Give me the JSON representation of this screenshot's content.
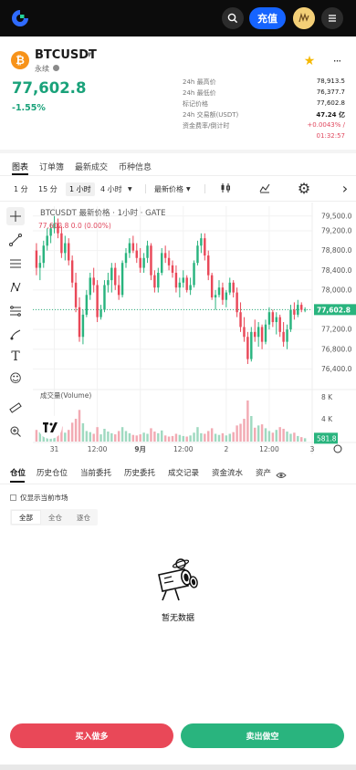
{
  "app": {
    "deposit_label": "充值"
  },
  "ticker": {
    "symbol": "BTCUSDT",
    "contract_type": "永续",
    "last_price": "77,602.8",
    "change_pct": "-1.55%",
    "stats": [
      {
        "label": "24h 最高价",
        "value": "78,913.5"
      },
      {
        "label": "24h 最低价",
        "value": "76,377.7"
      },
      {
        "label": "标记价格",
        "value": "77,602.8"
      },
      {
        "label": "24h 交易额(USDT)",
        "value": "47.24 亿"
      },
      {
        "label": "资金费率/倒计时",
        "value": "+0.0043% /"
      }
    ],
    "funding_countdown": "01:32:57"
  },
  "tabs": [
    "图表",
    "订单簿",
    "最新成交",
    "币种信息"
  ],
  "toolbar": {
    "intervals": [
      "1 分",
      "15 分",
      "1 小时",
      "4 小时"
    ],
    "active_interval": "1 小时",
    "price_mode": "最新价格"
  },
  "chart_header": {
    "title": "BTCUSDT 最新价格 · 1小时 · GATE",
    "ohlc": "77,602.8  0.0 (0.00%)",
    "volume_label": "成交量(Volume)"
  },
  "chart_data": {
    "type": "candlestick",
    "interval": "1h",
    "y_ticks": [
      "79,500.0",
      "79,200.0",
      "78,800.0",
      "78,400.0",
      "78,000.0",
      "77,600.0",
      "77,200.0",
      "76,800.0",
      "76,400.0"
    ],
    "y_tick_values": [
      79500,
      79200,
      78800,
      78400,
      78000,
      77600,
      77200,
      76800,
      76400
    ],
    "ylim": [
      76000,
      79700
    ],
    "last_price": 77602.8,
    "last_price_label": "77,602.8",
    "volume_ticks": [
      "8 K",
      "4 K"
    ],
    "volume_tick_values": [
      8000,
      4000
    ],
    "volume_ylim": [
      0,
      9200
    ],
    "last_volume_label": "581.8",
    "x_ticks": [
      "31",
      "12:00",
      "9月",
      "12:00",
      "2",
      "12:00",
      "3"
    ],
    "x_tick_index": [
      5,
      17,
      29,
      41,
      53,
      65,
      77
    ],
    "candles": [
      [
        78800,
        78950,
        78300,
        78450
      ],
      [
        78450,
        78700,
        78200,
        78550
      ],
      [
        78550,
        79000,
        78450,
        78900
      ],
      [
        78900,
        79250,
        78800,
        79100
      ],
      [
        79100,
        79350,
        78950,
        79250
      ],
      [
        79250,
        79500,
        79150,
        79350
      ],
      [
        79350,
        79450,
        79050,
        79150
      ],
      [
        79150,
        79300,
        78650,
        78750
      ],
      [
        78750,
        79100,
        78600,
        78950
      ],
      [
        78950,
        79050,
        78500,
        78600
      ],
      [
        78600,
        78700,
        78050,
        78150
      ],
      [
        78150,
        78350,
        77550,
        77650
      ],
      [
        77650,
        77850,
        76950,
        77050
      ],
      [
        77050,
        77600,
        76900,
        77500
      ],
      [
        77500,
        78000,
        77450,
        77900
      ],
      [
        77900,
        78350,
        77800,
        78250
      ],
      [
        78250,
        78450,
        77950,
        78100
      ],
      [
        78100,
        78200,
        77350,
        77450
      ],
      [
        77450,
        77700,
        77400,
        77600
      ],
      [
        77600,
        78200,
        77550,
        78100
      ],
      [
        78100,
        78350,
        77950,
        78200
      ],
      [
        78200,
        78550,
        77950,
        78450
      ],
      [
        78450,
        78550,
        78000,
        78100
      ],
      [
        78100,
        78300,
        77800,
        77900
      ],
      [
        77900,
        78600,
        77850,
        78550
      ],
      [
        78550,
        78850,
        78450,
        78750
      ],
      [
        78750,
        79050,
        78650,
        78950
      ],
      [
        78950,
        79100,
        78750,
        78800
      ],
      [
        78800,
        78950,
        78550,
        78650
      ],
      [
        78650,
        78850,
        78350,
        78450
      ],
      [
        78450,
        78750,
        78350,
        78650
      ],
      [
        78650,
        79000,
        78550,
        78900
      ],
      [
        78900,
        78950,
        78200,
        78300
      ],
      [
        78300,
        78400,
        77950,
        78050
      ],
      [
        78050,
        78450,
        77950,
        78350
      ],
      [
        78350,
        78850,
        78300,
        78750
      ],
      [
        78750,
        78900,
        78550,
        78650
      ],
      [
        78650,
        78800,
        78400,
        78500
      ],
      [
        78500,
        78600,
        78250,
        78350
      ],
      [
        78350,
        78500,
        77950,
        78050
      ],
      [
        78050,
        78250,
        77850,
        78150
      ],
      [
        78150,
        78400,
        78050,
        78250
      ],
      [
        78250,
        78300,
        77950,
        78000
      ],
      [
        78000,
        78250,
        77900,
        78100
      ],
      [
        78100,
        78600,
        78050,
        78550
      ],
      [
        78550,
        79000,
        78500,
        78900
      ],
      [
        78900,
        79150,
        78750,
        79050
      ],
      [
        79050,
        79150,
        78600,
        78700
      ],
      [
        78700,
        78800,
        78200,
        78300
      ],
      [
        78300,
        78350,
        77800,
        77850
      ],
      [
        77850,
        78000,
        77600,
        77900
      ],
      [
        77900,
        78200,
        77850,
        78050
      ],
      [
        78050,
        78150,
        77700,
        77800
      ],
      [
        77800,
        78000,
        77650,
        77950
      ],
      [
        77950,
        78250,
        77900,
        78150
      ],
      [
        78150,
        78200,
        77850,
        77950
      ],
      [
        77950,
        78050,
        77450,
        77550
      ],
      [
        77550,
        77750,
        77150,
        77250
      ],
      [
        77250,
        77450,
        76950,
        77050
      ],
      [
        77050,
        77150,
        76500,
        76600
      ],
      [
        76600,
        77250,
        76550,
        77150
      ],
      [
        77150,
        77400,
        76950,
        77050
      ],
      [
        77050,
        77350,
        76850,
        77250
      ],
      [
        77250,
        77300,
        76800,
        76950
      ],
      [
        76950,
        77400,
        76900,
        77300
      ],
      [
        77300,
        77650,
        77200,
        77550
      ],
      [
        77550,
        77600,
        77250,
        77350
      ],
      [
        77350,
        77550,
        77100,
        77450
      ],
      [
        77450,
        77500,
        77050,
        77150
      ],
      [
        77150,
        77350,
        76850,
        76950
      ],
      [
        76950,
        77300,
        76800,
        77200
      ],
      [
        77200,
        77700,
        77150,
        77600
      ],
      [
        77600,
        77750,
        77400,
        77500
      ],
      [
        77500,
        77800,
        77450,
        77700
      ],
      [
        77700,
        77750,
        77550,
        77600
      ],
      [
        77600,
        77650,
        77550,
        77602.8
      ]
    ],
    "volumes": [
      2100,
      1700,
      3000,
      2600,
      1900,
      3300,
      1500,
      2700,
      1600,
      2100,
      3400,
      4100,
      5700,
      3300,
      1900,
      1700,
      1400,
      2600,
      1300,
      2300,
      1800,
      1500,
      1300,
      1900,
      2600,
      1900,
      1500,
      1200,
      1100,
      1300,
      1600,
      1400,
      2400,
      1800,
      1500,
      2000,
      1100,
      900,
      1000,
      1400,
      1200,
      1000,
      900,
      1100,
      1600,
      2600,
      1500,
      1400,
      1900,
      2400,
      1400,
      1200,
      1500,
      1100,
      1400,
      1700,
      2900,
      3200,
      4100,
      7400,
      4600,
      2500,
      2900,
      3100,
      2400,
      1900,
      1600,
      2100,
      2600,
      2300,
      1800,
      1400,
      1600,
      1000,
      800,
      600
    ]
  },
  "positions": {
    "tabs": [
      "仓位",
      "历史仓位",
      "当前委托",
      "历史委托",
      "成交记录",
      "资金流水",
      "资产"
    ],
    "filter_label": "仅显示当前市场",
    "modes": [
      "全部",
      "全仓",
      "逐仓"
    ],
    "empty_text": "暂无数据"
  },
  "actions": {
    "buy_label": "买入做多",
    "sell_label": "卖出做空"
  },
  "colors": {
    "up": "#29b47e",
    "down": "#e94858",
    "accent": "#1664ff"
  }
}
